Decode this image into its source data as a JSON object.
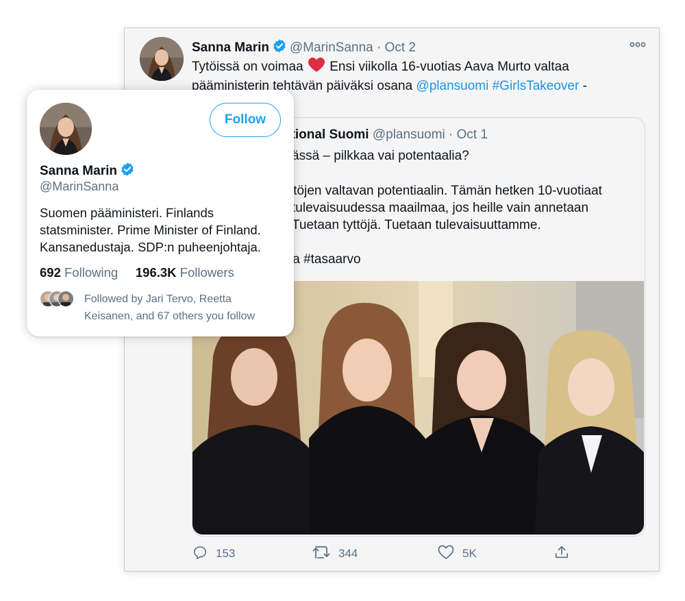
{
  "tweet": {
    "author_name": "Sanna Marin",
    "handle": "@MarinSanna",
    "separator": "·",
    "date": "Oct 2",
    "text_part1": "Tytöissä on voimaa",
    "text_part2": " Ensi viikolla 16-vuotias Aava Murto valtaa pääministerin tehtävän päiväksi osana ",
    "mention": "@plansuomi",
    "space": " ",
    "hashtag": "#GirlsTakeover",
    "text_tail": " -",
    "more_icon": "more-horizontal-icon",
    "heart_icon": "red-heart-emoji"
  },
  "quote": {
    "author_name_visible": "ational Suomi",
    "handle": "@plansuomi",
    "separator": "·",
    "date": "Oct 1",
    "line1": "ässä – pilkkaa vai potentaalia?",
    "line2": "ttöjen valtavan potentiaalin. Tämän hetken 10-vuotiaat",
    "line3": "tulevaisuudessa maailmaa, jos heille vain annetaan",
    "line4": "Tuetaan tyttöjä. Tuetaan tulevaisuuttamme.",
    "line5": "la #tasaarvo"
  },
  "actions": {
    "reply_count": "153",
    "retweet_count": "344",
    "like_count": "5K",
    "reply_icon": "reply-icon",
    "retweet_icon": "retweet-icon",
    "like_icon": "heart-outline-icon",
    "share_icon": "share-icon"
  },
  "hover_card": {
    "name": "Sanna Marin",
    "handle": "@MarinSanna",
    "follow_label": "Follow",
    "bio_line1": "Suomen pääministeri. Finlands",
    "bio_line2": "statsminister. Prime Minister of Finland.",
    "bio_line3": "Kansanedustaja. SDP:n puheenjohtaja.",
    "following_count": "692",
    "following_label": "Following",
    "followers_count": "196.3K",
    "followers_label": "Followers",
    "followed_by_line1": "Followed by Jari Tervo, Reetta",
    "followed_by_line2": "Keisanen, and 67 others you follow"
  },
  "colors": {
    "accent": "#1da1f2",
    "link": "#1b95e0",
    "muted": "#5b7083",
    "heart": "#e0245e"
  }
}
